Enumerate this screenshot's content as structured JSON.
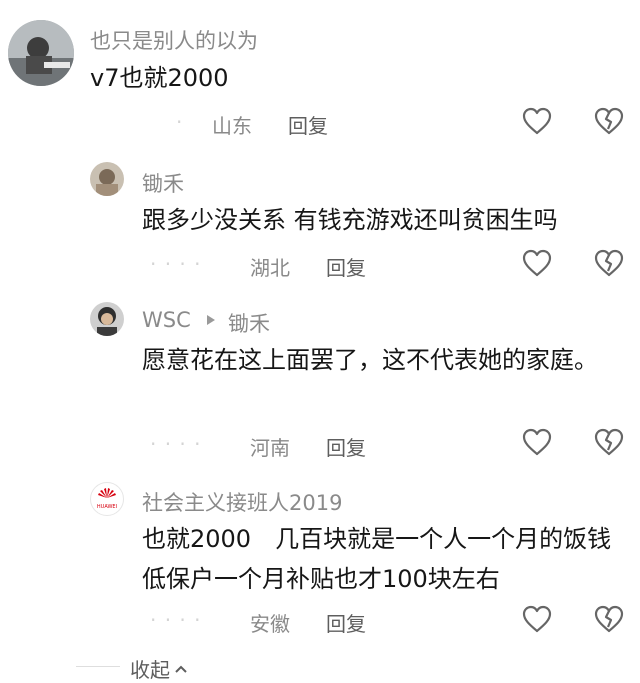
{
  "comments": [
    {
      "username": "也只是别人的以为",
      "text": "v7也就2000",
      "location": "山东",
      "reply_label": "回复"
    },
    {
      "username": "锄禾",
      "text": "跟多少没关系 有钱充游戏还叫贫困生吗",
      "location": "湖北",
      "reply_label": "回复"
    },
    {
      "username": "WSC",
      "reply_to": "锄禾",
      "text": "愿意花在这上面罢了，这不代表她的家庭。",
      "location": "河南",
      "reply_label": "回复"
    },
    {
      "username": "社会主义接班人2019",
      "text": "也就2000　几百块就是一个人一个月的饭钱 低保户一个月补贴也才100块左右",
      "location": "安徽",
      "reply_label": "回复",
      "avatar_logo": "HUAWEI"
    }
  ],
  "collapse_label": "收起",
  "icons": {
    "like": "heart-outline-icon",
    "dislike": "broken-heart-icon",
    "reply_arrow": "triangle-right-icon",
    "collapse": "chevron-up-icon"
  },
  "colors": {
    "username": "#8a8a8a",
    "text": "#161616",
    "icon": "#666666",
    "huawei_red": "#d7000f"
  }
}
